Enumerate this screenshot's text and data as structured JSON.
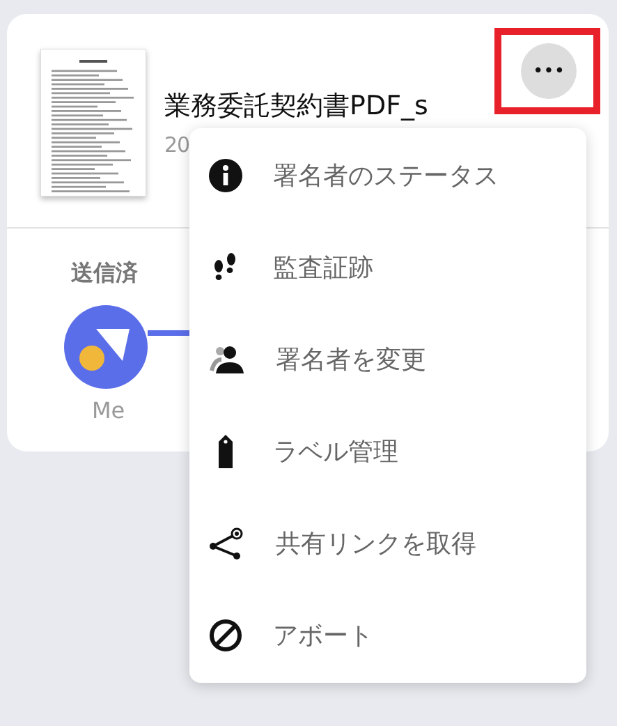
{
  "document": {
    "title": "業務委託契約書PDF_s",
    "date": "20"
  },
  "more_button": {
    "label": "•••",
    "highlighted": true
  },
  "signers": [
    {
      "status": "送信済",
      "name": "Me"
    }
  ],
  "menu": [
    {
      "kind": "info",
      "label": "署名者のステータス"
    },
    {
      "kind": "footprints",
      "label": "監査証跡"
    },
    {
      "kind": "person",
      "label": "署名者を変更"
    },
    {
      "kind": "tag",
      "label": "ラベル管理"
    },
    {
      "kind": "share",
      "label": "共有リンクを取得"
    },
    {
      "kind": "block",
      "label": "アボート"
    }
  ]
}
